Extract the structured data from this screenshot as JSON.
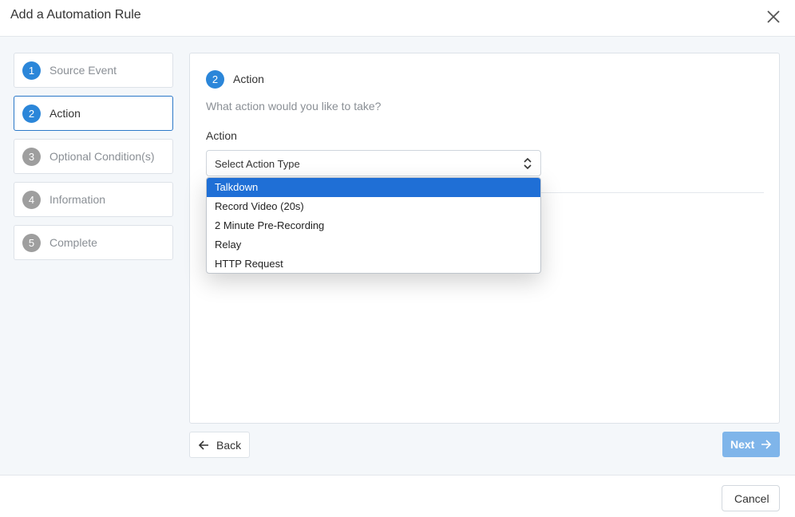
{
  "dialog": {
    "title": "Add a Automation Rule",
    "close_icon": "close-icon"
  },
  "steps": [
    {
      "number": "1",
      "label": "Source Event",
      "state": "done"
    },
    {
      "number": "2",
      "label": "Action",
      "state": "active"
    },
    {
      "number": "3",
      "label": "Optional Condition(s)",
      "state": "pending"
    },
    {
      "number": "4",
      "label": "Information",
      "state": "pending"
    },
    {
      "number": "5",
      "label": "Complete",
      "state": "pending"
    }
  ],
  "panel": {
    "step_number": "2",
    "step_title": "Action",
    "subtitle": "What action would you like to take?",
    "field_label": "Action",
    "select": {
      "value": "Select Action Type",
      "options": [
        "Talkdown",
        "Record Video (20s)",
        "2 Minute Pre-Recording",
        "Relay",
        "HTTP Request"
      ],
      "highlighted": "Talkdown"
    }
  },
  "nav": {
    "back_label": "Back",
    "next_label": "Next"
  },
  "footer": {
    "cancel_label": "Cancel"
  },
  "colors": {
    "accent": "#2b86d9",
    "next_disabled": "#7fb5ea",
    "highlight": "#1f6fd6"
  }
}
